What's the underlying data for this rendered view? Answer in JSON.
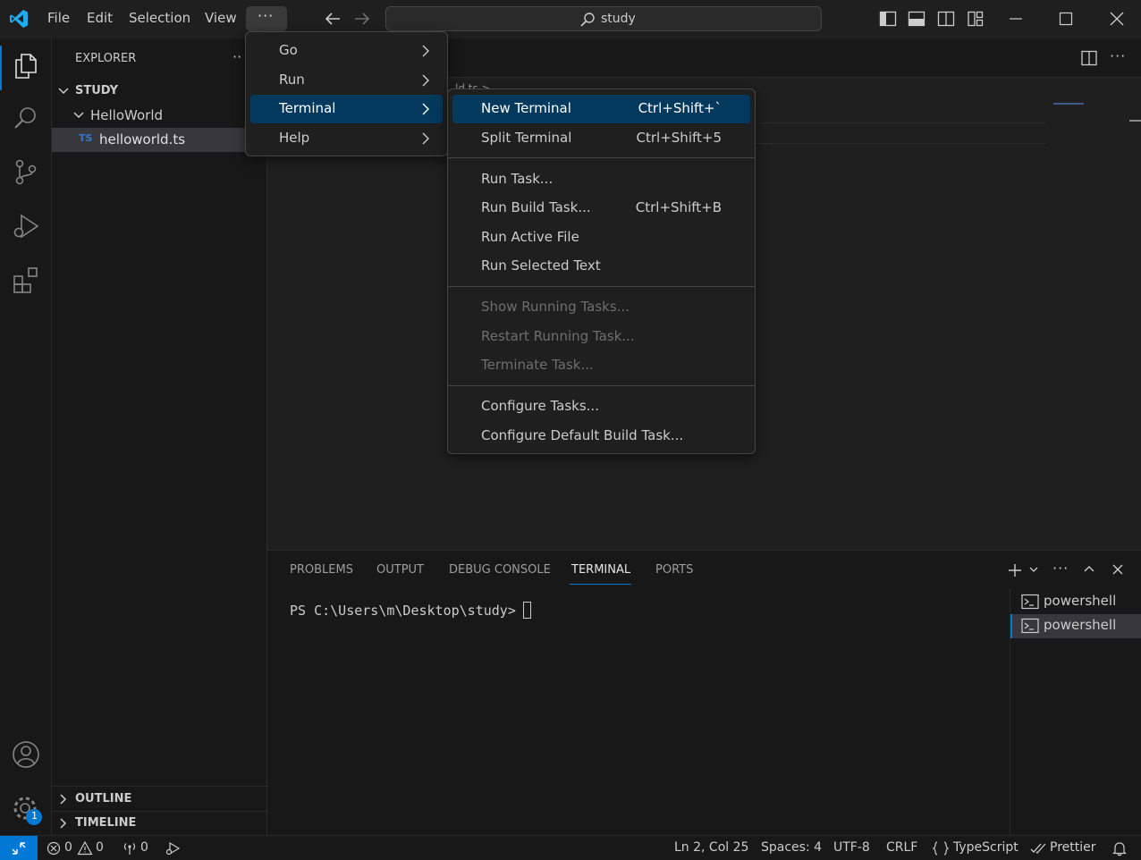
{
  "titlebar": {
    "menus": [
      "File",
      "Edit",
      "Selection",
      "View"
    ],
    "more_label": "···",
    "search_text": "study"
  },
  "sidebar": {
    "title": "EXPLORER",
    "more": "··",
    "root": "STUDY",
    "folder": "HelloWorld",
    "file_badge": "TS",
    "file": "helloworld.ts",
    "outline": "OUTLINE",
    "timeline": "TIMELINE"
  },
  "editor": {
    "breadcrumb_fragment": "ld.ts >"
  },
  "menus": {
    "more_menu": [
      {
        "label": "Go"
      },
      {
        "label": "Run"
      },
      {
        "label": "Terminal"
      },
      {
        "label": "Help"
      }
    ],
    "terminal_menu": {
      "group1": [
        {
          "label": "New Terminal",
          "shortcut": "Ctrl+Shift+`"
        },
        {
          "label": "Split Terminal",
          "shortcut": "Ctrl+Shift+5"
        }
      ],
      "group2": [
        {
          "label": "Run Task...",
          "shortcut": ""
        },
        {
          "label": "Run Build Task...",
          "shortcut": "Ctrl+Shift+B"
        },
        {
          "label": "Run Active File",
          "shortcut": ""
        },
        {
          "label": "Run Selected Text",
          "shortcut": ""
        }
      ],
      "group3": [
        {
          "label": "Show Running Tasks..."
        },
        {
          "label": "Restart Running Task..."
        },
        {
          "label": "Terminate Task..."
        }
      ],
      "group4": [
        {
          "label": "Configure Tasks..."
        },
        {
          "label": "Configure Default Build Task..."
        }
      ]
    }
  },
  "panel": {
    "tabs": [
      "PROBLEMS",
      "OUTPUT",
      "DEBUG CONSOLE",
      "TERMINAL",
      "PORTS"
    ],
    "active_tab": "TERMINAL",
    "prompt": "PS C:\\Users\\m\\Desktop\\study> ",
    "terminals": [
      "powershell",
      "powershell"
    ]
  },
  "statusbar": {
    "errors": "0",
    "warnings": "0",
    "ports": "0",
    "position": "Ln 2, Col 25",
    "spaces": "Spaces: 4",
    "encoding": "UTF-8",
    "eol": "CRLF",
    "language": "TypeScript",
    "formatter": "Prettier"
  },
  "badges": {
    "settings_badge": "1"
  },
  "colors": {
    "accent": "#0078d4",
    "menu_highlight": "#04395e",
    "remote_button": "#0078d4",
    "vscode_logo": "#23a9f2"
  }
}
